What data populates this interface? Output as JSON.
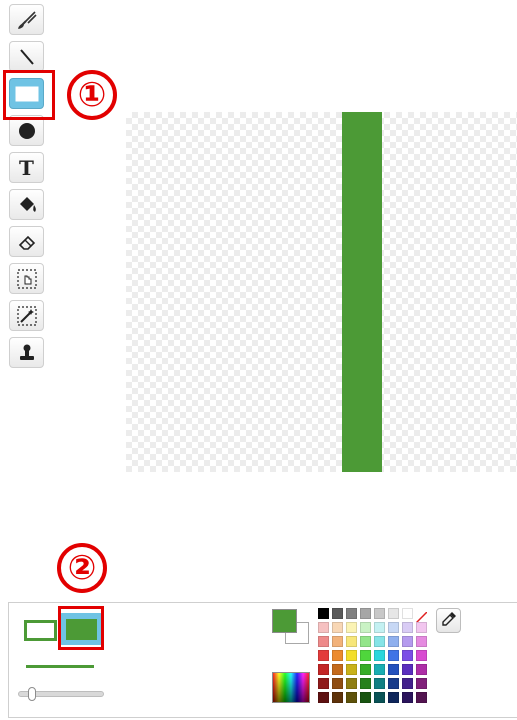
{
  "toolbar": {
    "tools": [
      {
        "id": "brush",
        "icon": "brush-icon"
      },
      {
        "id": "line",
        "icon": "line-icon"
      },
      {
        "id": "rectangle",
        "icon": "rectangle-icon",
        "selected": true
      },
      {
        "id": "ellipse",
        "icon": "ellipse-icon"
      },
      {
        "id": "text",
        "icon": "text-icon",
        "glyph": "T"
      },
      {
        "id": "fill",
        "icon": "paint-bucket-icon"
      },
      {
        "id": "eraser",
        "icon": "eraser-icon"
      },
      {
        "id": "select",
        "icon": "select-icon"
      },
      {
        "id": "reshape",
        "icon": "magic-select-icon"
      },
      {
        "id": "stamp",
        "icon": "stamp-icon"
      }
    ]
  },
  "annotations": {
    "callout_1": "①",
    "callout_2": "②",
    "highlight_color": "#e20000"
  },
  "canvas": {
    "shape_type": "rectangle",
    "shape_color": "#4c9a36"
  },
  "options": {
    "fill_modes": [
      "outline",
      "solid"
    ],
    "selected_fill_mode": "solid",
    "line_width_level": 0.12,
    "primary_color": "#4c9a36",
    "secondary_color": "#ffffff"
  },
  "palette": {
    "rows": [
      [
        "#000000",
        "#5a5a5a",
        "#808080",
        "#a6a6a6",
        "#c8c8c8",
        "#e6e6e6",
        "#ffffff",
        "none"
      ],
      [
        "#f6c1c1",
        "#f8d7b5",
        "#fbf3b4",
        "#c9f2c4",
        "#c4f1f2",
        "#c7d8f5",
        "#d9ccf5",
        "#f2c6ef"
      ],
      [
        "#ee8a8a",
        "#f2b27a",
        "#f7e67a",
        "#93e58a",
        "#86e4e7",
        "#8fb0ee",
        "#b59bee",
        "#e58be0"
      ],
      [
        "#e33b3b",
        "#ec8b2e",
        "#f3de2b",
        "#4fd63c",
        "#2bd7dc",
        "#3f74e6",
        "#7b4ee6",
        "#d84bd1"
      ],
      [
        "#c32525",
        "#c46a1b",
        "#c9b21a",
        "#37ad28",
        "#1aaeb2",
        "#2250bd",
        "#5a2ebe",
        "#ae2ea7"
      ],
      [
        "#8f1a1a",
        "#8f4d12",
        "#8f7e12",
        "#26801b",
        "#127f83",
        "#173a8a",
        "#42208b",
        "#80207a"
      ],
      [
        "#5e1010",
        "#5e320a",
        "#5e520a",
        "#185410",
        "#0a5356",
        "#0e265b",
        "#2b145c",
        "#531450"
      ]
    ]
  }
}
